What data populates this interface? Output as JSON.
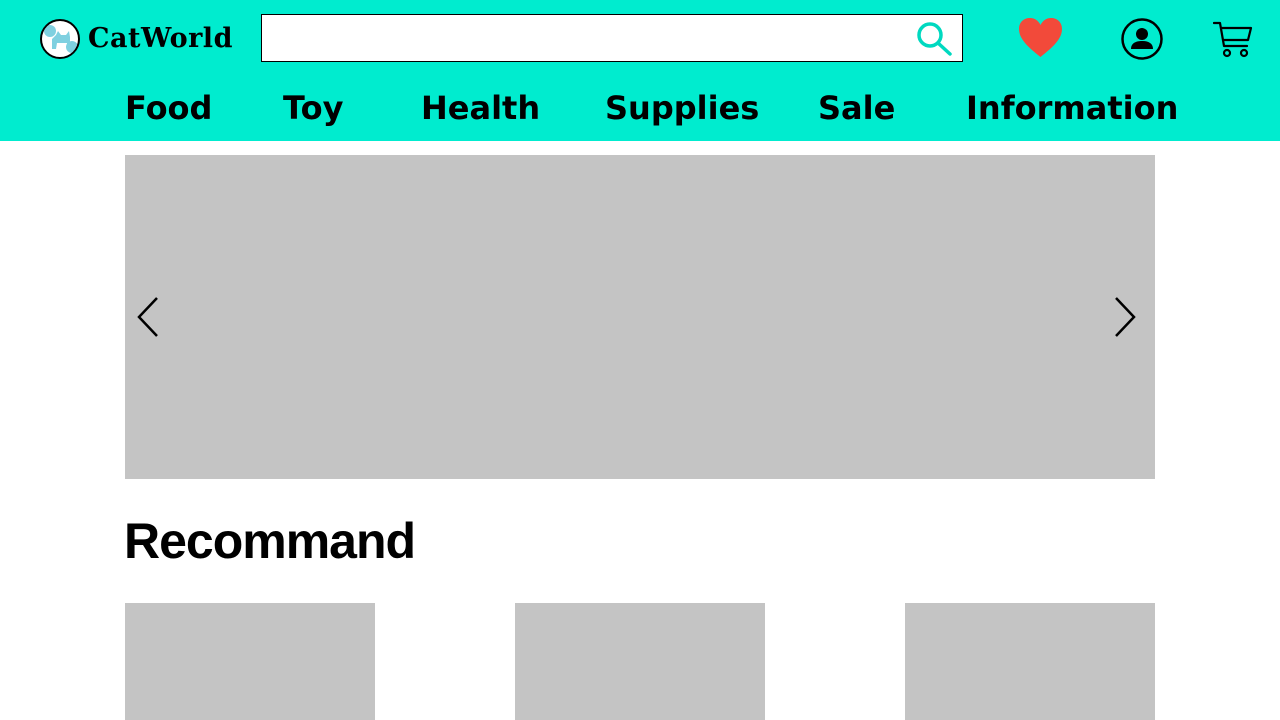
{
  "header": {
    "brand": "CatWorld",
    "search": {
      "value": "",
      "placeholder": ""
    }
  },
  "nav": {
    "items": [
      "Food",
      "Toy",
      "Health",
      "Supplies",
      "Sale",
      "Information"
    ]
  },
  "recommend": {
    "title": "Recommand"
  },
  "colors": {
    "header_bg": "#00ECCF",
    "favorite": "#F24A3A",
    "search_icon": "#00D9C0",
    "placeholder_image": "#C4C4C4",
    "logo_accent": "#7FD0E0"
  },
  "icons": {
    "logo": "cat-logo-icon",
    "search": "search-icon",
    "favorite": "heart-icon",
    "account": "user-circle-icon",
    "cart": "cart-icon",
    "prev": "chevron-left-icon",
    "next": "chevron-right-icon"
  }
}
